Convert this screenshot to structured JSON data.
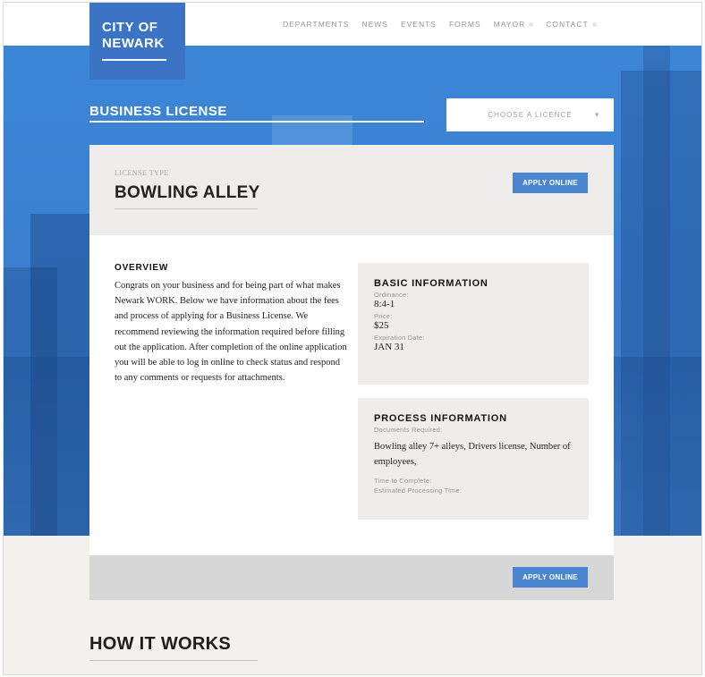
{
  "brand": {
    "line1": "CITY OF",
    "line2": "NEWARK"
  },
  "nav": [
    {
      "label": "DEPARTMENTS",
      "has_dot": false
    },
    {
      "label": "NEWS",
      "has_dot": false
    },
    {
      "label": "EVENTS",
      "has_dot": false
    },
    {
      "label": "FORMS",
      "has_dot": false
    },
    {
      "label": "MAYOR",
      "has_dot": true
    },
    {
      "label": "CONTACT",
      "has_dot": true
    }
  ],
  "section": {
    "title": "BUSINESS LICENSE"
  },
  "license_select": {
    "placeholder": "CHOOSE A LICENCE",
    "chevron_icon": "chevron-down-icon"
  },
  "license": {
    "type_label": "LICENSE TYPE",
    "type_value": "BOWLING ALLEY"
  },
  "buttons": {
    "apply_top": "APPLY ONLINE",
    "apply_bottom": "APPLY ONLINE"
  },
  "overview": {
    "title": "OVERVIEW",
    "text": "Congrats on your business and for being part of what makes Newark WORK. Below we have information about the fees and process of applying for a Business License. We recommend reviewing the information required before filling out the application. After completion of the online application you will be able to log in online to check status and respond to any comments or requests for attachments."
  },
  "basic_info": {
    "title": "BASIC INFORMATION",
    "ordinance_label": "Ordinance:",
    "ordinance_value": "8:4-1",
    "price_label": "Price:",
    "price_value": "$25",
    "expiration_label": "Expiration Date:",
    "expiration_value": "JAN 31"
  },
  "process_info": {
    "title": "PROCESS INFORMATION",
    "documents_label": "Documents Required:",
    "documents_value": "Bowling alley 7+ alleys, Drivers license, Number of employees,",
    "time_label": "Time to Complete:",
    "processing_label": "Estimated Processing Time:"
  },
  "how_it_works": {
    "title": "HOW IT WORKS"
  },
  "colors": {
    "brand_blue": "#3b74c4",
    "button_blue": "#4a86cf",
    "hero_blue": "#3d86d6"
  }
}
